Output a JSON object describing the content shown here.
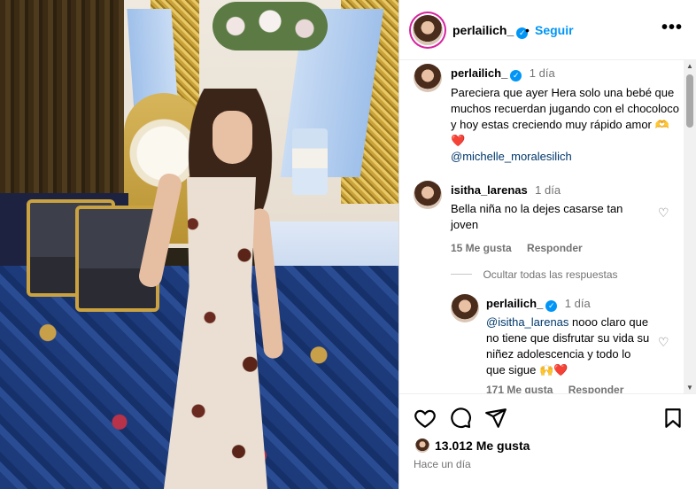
{
  "post": {
    "username": "perlailich_",
    "dot": "•",
    "follow_label": "Seguir",
    "more_label": "•••"
  },
  "caption": {
    "username": "perlailich_",
    "time": "1 día",
    "text": "Pareciera que ayer Hera solo una bebé que muchos recuerdan jugando con el chocoloco y hoy estas creciendo muy rápido amor 🫶❤️",
    "mention": "@michelle_moralesilich"
  },
  "comments": [
    {
      "username": "isitha_larenas",
      "time": "1 día",
      "text": "Bella niña no la dejes casarse tan joven",
      "likes": "15 Me gusta",
      "reply_label": "Responder",
      "hide_replies_label": "Ocultar todas las respuestas",
      "replies": [
        {
          "username": "perlailich_",
          "time": "1 día",
          "mention": "@isitha_larenas",
          "text": "nooo claro que no tiene que disfrutar su vida su niñez adolescencia y todo lo que sigue 🙌❤️",
          "likes": "171 Me gusta",
          "reply_label": "Responder"
        }
      ]
    }
  ],
  "footer": {
    "likes": "13.012 Me gusta",
    "when": "Hace un día"
  },
  "icons": {
    "like": "heart-icon",
    "comment": "comment-icon",
    "share": "send-icon",
    "save": "bookmark-icon",
    "verified": "verified-badge-icon"
  },
  "colors": {
    "link_blue": "#0095f6",
    "mention_blue": "#00376b",
    "heart_red": "#ed4956",
    "muted_gray": "#737373"
  }
}
